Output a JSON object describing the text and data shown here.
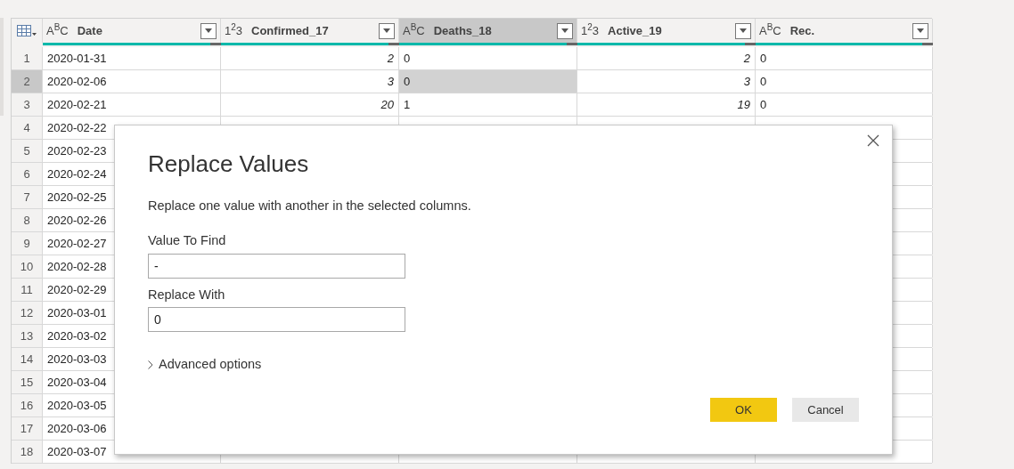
{
  "table": {
    "columns": [
      {
        "kind": "text",
        "type_label": "A$^{B}$C",
        "name": "Date",
        "selected": false
      },
      {
        "kind": "number",
        "type_label": "1$^{2}$3",
        "name": "Confirmed_17",
        "selected": false
      },
      {
        "kind": "text",
        "type_label": "A$^{B}$C",
        "name": "Deaths_18",
        "selected": true
      },
      {
        "kind": "number",
        "type_label": "1$^{2}$3",
        "name": "Active_19",
        "selected": false
      },
      {
        "kind": "text",
        "type_label": "A$^{B}$C",
        "name": "Rec.",
        "selected": false
      }
    ],
    "rows": [
      {
        "number": "1",
        "selected": false,
        "cells": [
          "2020-01-31",
          "2",
          "0",
          "2",
          "0"
        ]
      },
      {
        "number": "2",
        "selected": true,
        "cells": [
          "2020-02-06",
          "3",
          "0",
          "3",
          "0"
        ]
      },
      {
        "number": "3",
        "selected": false,
        "cells": [
          "2020-02-21",
          "20",
          "1",
          "19",
          "0"
        ]
      },
      {
        "number": "4",
        "selected": false,
        "cells": [
          "2020-02-22"
        ]
      },
      {
        "number": "5",
        "selected": false,
        "cells": [
          "2020-02-23"
        ]
      },
      {
        "number": "6",
        "selected": false,
        "cells": [
          "2020-02-24"
        ]
      },
      {
        "number": "7",
        "selected": false,
        "cells": [
          "2020-02-25"
        ]
      },
      {
        "number": "8",
        "selected": false,
        "cells": [
          "2020-02-26"
        ]
      },
      {
        "number": "9",
        "selected": false,
        "cells": [
          "2020-02-27"
        ]
      },
      {
        "number": "10",
        "selected": false,
        "cells": [
          "2020-02-28"
        ]
      },
      {
        "number": "11",
        "selected": false,
        "cells": [
          "2020-02-29"
        ]
      },
      {
        "number": "12",
        "selected": false,
        "cells": [
          "2020-03-01"
        ]
      },
      {
        "number": "13",
        "selected": false,
        "cells": [
          "2020-03-02"
        ]
      },
      {
        "number": "14",
        "selected": false,
        "cells": [
          "2020-03-03"
        ]
      },
      {
        "number": "15",
        "selected": false,
        "cells": [
          "2020-03-04"
        ]
      },
      {
        "number": "16",
        "selected": false,
        "cells": [
          "2020-03-05"
        ]
      },
      {
        "number": "17",
        "selected": false,
        "cells": [
          "2020-03-06"
        ]
      },
      {
        "number": "18",
        "selected": false,
        "cells": [
          "2020-03-07"
        ]
      }
    ]
  },
  "dialog": {
    "title": "Replace Values",
    "description": "Replace one value with another in the selected columns.",
    "fields": [
      {
        "label": "Value To Find",
        "value": "-"
      },
      {
        "label": "Replace With",
        "value": "0"
      }
    ],
    "advanced": {
      "label": "Advanced options",
      "expanded": false
    },
    "buttons": [
      {
        "label": "OK",
        "kind": "primary"
      },
      {
        "label": "Cancel",
        "kind": "secondary"
      }
    ]
  }
}
